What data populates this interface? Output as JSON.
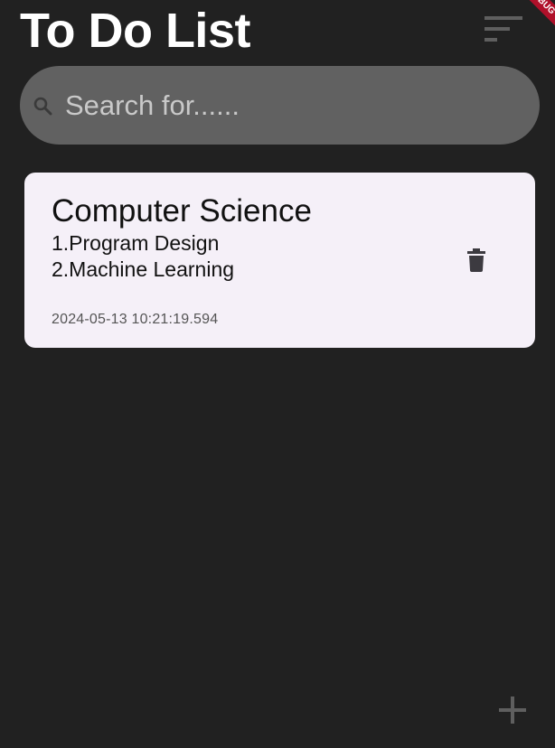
{
  "header": {
    "title": "To Do List",
    "sort_icon": "sort-lines-icon"
  },
  "debug_banner": {
    "label": "DEBUG",
    "color": "#b0102a"
  },
  "search": {
    "placeholder": "Search for......",
    "value": "",
    "icon": "search-icon"
  },
  "notes": [
    {
      "title": "Computer Science",
      "lines": [
        "1.Program Design",
        "2.Machine Learning"
      ],
      "timestamp": "2024-05-13 10:21:19.594",
      "action_icon": "trash-icon"
    }
  ],
  "fab": {
    "icon": "plus-icon"
  },
  "colors": {
    "background": "#212121",
    "search_bg": "#616161",
    "card_bg": "#f5f0f8",
    "icon_gray": "#5f5f5f"
  }
}
